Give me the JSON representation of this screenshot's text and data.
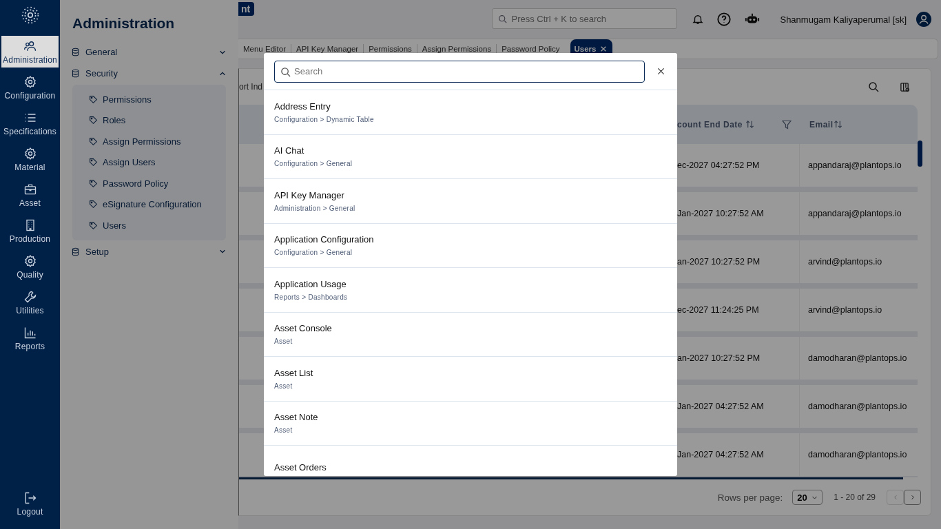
{
  "rail": {
    "items": [
      {
        "label": "Administration",
        "selected": true
      },
      {
        "label": "Configuration",
        "selected": false
      },
      {
        "label": "Specifications",
        "selected": false
      },
      {
        "label": "Material",
        "selected": false
      },
      {
        "label": "Asset",
        "selected": false
      },
      {
        "label": "Production",
        "selected": false
      },
      {
        "label": "Quality",
        "selected": false
      },
      {
        "label": "Utilities",
        "selected": false
      },
      {
        "label": "Reports",
        "selected": false
      }
    ],
    "logout": "Logout"
  },
  "panel": {
    "title": "Administration",
    "groups": [
      {
        "label": "General",
        "expanded": false
      },
      {
        "label": "Security",
        "expanded": true,
        "children": [
          {
            "label": "Permissions"
          },
          {
            "label": "Roles"
          },
          {
            "label": "Assign Permissions"
          },
          {
            "label": "Assign Users"
          },
          {
            "label": "Password Policy"
          },
          {
            "label": "eSignature Configuration"
          },
          {
            "label": "Users"
          }
        ]
      },
      {
        "label": "Setup",
        "expanded": false
      }
    ]
  },
  "header": {
    "badge": "nt",
    "search_placeholder": "Press Ctrl + K to search",
    "user": "Shanmugam Kaliyaperumal [sk]"
  },
  "tabs": [
    {
      "label": "Menu Editor",
      "selected": false
    },
    {
      "label": "API Key Manager",
      "selected": false
    },
    {
      "label": "Permissions",
      "selected": false
    },
    {
      "label": "Assign Permissions",
      "selected": false
    },
    {
      "label": "Password Policy",
      "selected": false
    },
    {
      "label": "Users",
      "selected": true
    }
  ],
  "toolbar": {
    "text": "ort Ind"
  },
  "table": {
    "columns": [
      "count End Date",
      "Email"
    ],
    "rows": [
      {
        "date": "ec-2027 04:27:52 PM",
        "email": "appandaraj@plantops.io"
      },
      {
        "date": "Jan-2027 10:27:52 AM",
        "email": "appandaraj@plantops.io"
      },
      {
        "date": "an-2027 10:27:52 PM",
        "email": "arvind@plantops.io"
      },
      {
        "date": "ec-2027 11:24:25 PM",
        "email": "arvind@plantops.io"
      },
      {
        "date": "an-2027 10:27:52 PM",
        "email": "damodharan@plantops.io"
      },
      {
        "date": "Jan-2027 04:27:52 AM",
        "email": "damodharan@plantops.io"
      },
      {
        "date": "Jan-2027 04:27:52 AM",
        "email": "damodharan@plantops.io"
      }
    ]
  },
  "pagination": {
    "label": "Rows per page:",
    "page_size": "20",
    "range": "1 - 20 of 29"
  },
  "modal": {
    "search_placeholder": "Search",
    "results": [
      {
        "title": "Address Entry",
        "path": "Configuration > Dynamic Table"
      },
      {
        "title": "AI Chat",
        "path": "Configuration > General"
      },
      {
        "title": "API Key Manager",
        "path": "Administration > General"
      },
      {
        "title": "Application Configuration",
        "path": "Configuration > General"
      },
      {
        "title": "Application Usage",
        "path": "Reports > Dashboards"
      },
      {
        "title": "Asset Console",
        "path": "Asset"
      },
      {
        "title": "Asset List",
        "path": "Asset"
      },
      {
        "title": "Asset Note",
        "path": "Asset"
      },
      {
        "title": "Asset Orders"
      }
    ]
  }
}
